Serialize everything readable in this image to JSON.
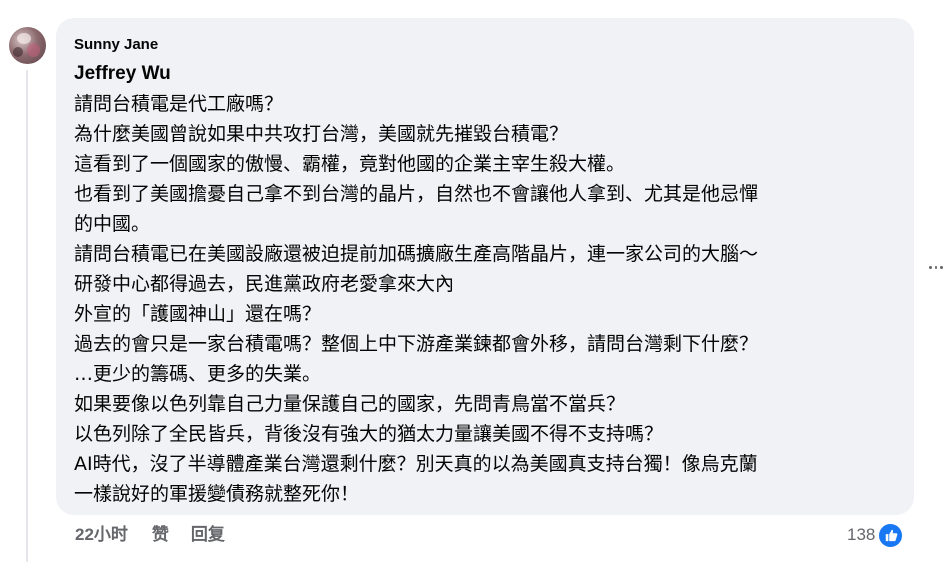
{
  "comment": {
    "author": "Sunny Jane",
    "mention": "Jeffrey Wu",
    "lines": [
      "請問台積電是代工廠嗎？",
      "為什麼美國曾說如果中共攻打台灣，美國就先摧毀台積電？",
      "這看到了一個國家的傲慢、霸權，竟對他國的企業主宰生殺大權。",
      "也看到了美國擔憂自己拿不到台灣的晶片，自然也不會讓他人拿到、尤其是他忌憚",
      "的中國。",
      "請問台積電已在美國設廠還被迫提前加碼擴廠生產高階晶片，連一家公司的大腦～",
      "研發中心都得過去，民進黨政府老愛拿來大內",
      "外宣的「護國神山」還在嗎？",
      "過去的會只是一家台積電嗎？整個上中下游產業鍊都會外移，請問台灣剩下什麼？",
      "…更少的籌碼、更多的失業。",
      "如果要像以色列靠自己力量保護自己的國家，先問青鳥當不當兵？",
      "以色列除了全民皆兵，背後沒有強大的猶太力量讓美國不得不支持嗎？",
      "AI時代，沒了半導體產業台灣還剩什麼？別天真的以為美國真支持台獨！像烏克蘭",
      "一樣說好的軍援變債務就整死你！"
    ]
  },
  "actions": {
    "time": "22小时",
    "like": "赞",
    "reply": "回复"
  },
  "reactions": {
    "count": "138",
    "icon": "like-icon"
  },
  "colors": {
    "bubble": "#f0f2f5",
    "meta": "#65676b",
    "like": "#1877f2"
  }
}
